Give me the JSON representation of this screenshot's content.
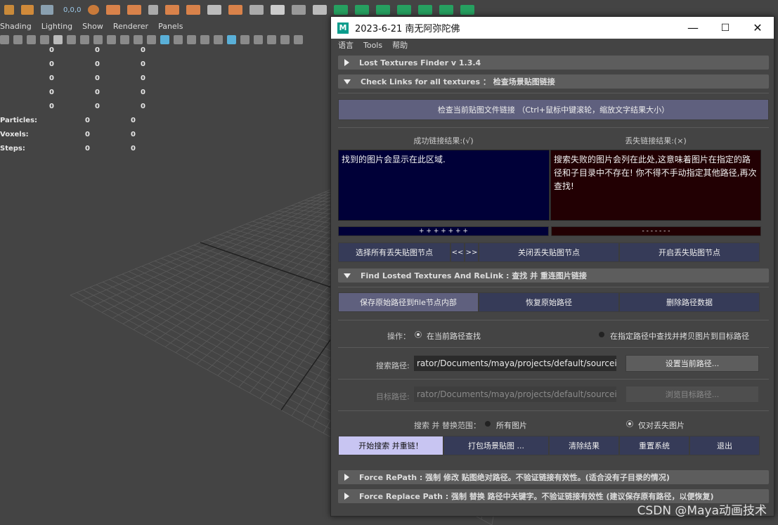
{
  "viewport": {
    "menu": [
      "Shading",
      "Lighting",
      "Show",
      "Renderer",
      "Panels"
    ],
    "stats_numbers": [
      [
        "0",
        "0",
        "0"
      ],
      [
        "0",
        "0",
        "0"
      ],
      [
        "0",
        "0",
        "0"
      ],
      [
        "0",
        "0",
        "0"
      ],
      [
        "0",
        "0",
        "0"
      ]
    ],
    "stats_named": [
      {
        "label": "Particles:",
        "a": "0",
        "b": "0"
      },
      {
        "label": "Voxels:",
        "a": "0",
        "b": "0"
      },
      {
        "label": "Steps:",
        "a": "0",
        "b": "0"
      }
    ],
    "shelf_readout": "0,0,0"
  },
  "window": {
    "app_icon": "M",
    "title": "2023-6-21  南无阿弥陀佛",
    "controls": {
      "minimize": "—",
      "maximize": "☐",
      "close": "✕"
    },
    "menu": [
      "语言",
      "Tools",
      "帮助"
    ]
  },
  "sections": {
    "finder": "Lost Textures Finder  v 1.3.4",
    "check": "Check Links for all textures ： 检查场景贴图链接",
    "find": "Find Losted Textures  And  ReLink : 查找 并 重连图片链接",
    "force_repath": "Force RePath : 强制 修改 贴图绝对路径。不验证链接有效性。(适合没有子目录的情况)",
    "force_replace": "Force Replace Path : 强制 替换 路径中关键字。不验证链接有效性 (建议保存原有路径，以便恢复)"
  },
  "check": {
    "check_button": "检查当前贴图文件链接  （Ctrl+鼠标中键滚轮，缩放文字结果大小）",
    "success_header": "成功链接结果:(√)",
    "fail_header": "丢失链接结果:(×)",
    "success_text": "找到的图片会显示在此区域.",
    "fail_text": "搜索失败的图片会列在此处,这意味着图片在指定的路径和子目录中不存在! 你不得不手动指定其他路径,再次查找!",
    "success_bar": "+ + + + + + +",
    "fail_bar": "- - - - - - -",
    "select_lost": "选择所有丢失贴图节点",
    "prev": "<<",
    "next": ">>",
    "close_lost": "关闭丢失贴图节点",
    "open_lost": "开启丢失贴图节点"
  },
  "find": {
    "save_path": "保存原始路径到file节点内部",
    "restore_path": "恢复原始路径",
    "delete_path": "删除路径数据",
    "operation_label": "操作：",
    "op_current": "在当前路径查找",
    "op_specified": "在指定路径中查找并拷贝图片到目标路径",
    "search_path_label": "搜索路径:",
    "search_path_value": "rator/Documents/maya/projects/default/sourceimages,",
    "set_current_path": "设置当前路径...",
    "target_path_label": "目标路径:",
    "target_path_value": "rator/Documents/maya/projects/default/sourceimages/",
    "browse_target": "浏览目标路径...",
    "scope_label": "搜索 并 替换范围：",
    "scope_all": "所有图片",
    "scope_lost": "仅对丢失图片",
    "start": "开始搜索 并重链！",
    "pack": "打包场景贴图 ...",
    "clear": "清除结果",
    "reset": "重置系统",
    "exit": "退出"
  },
  "watermark": "CSDN @Maya动画技术",
  "colors": {
    "success_bg": "#000038",
    "fail_bg": "#220003",
    "accent_button": "#c8c5f2",
    "panel_bg": "#444444"
  }
}
